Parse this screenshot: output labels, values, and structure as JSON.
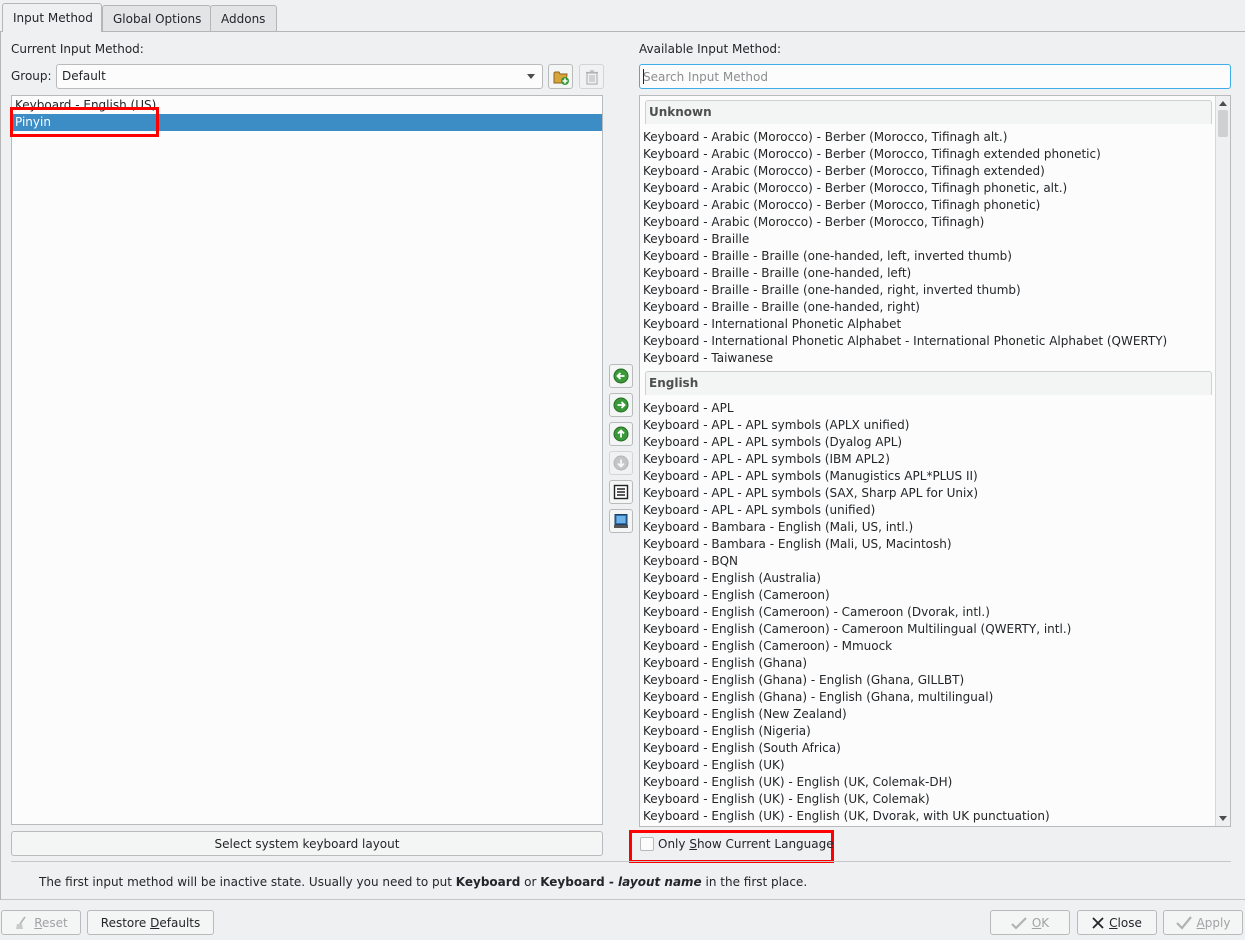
{
  "tabs": [
    {
      "label": "Input Method",
      "active": true
    },
    {
      "label": "Global Options",
      "active": false
    },
    {
      "label": "Addons",
      "active": false
    }
  ],
  "current": {
    "heading": "Current Input Method:",
    "group_label": "Group:",
    "group_value": "Default",
    "items": [
      {
        "label": "Keyboard - English (US)",
        "selected": false
      },
      {
        "label": "Pinyin",
        "selected": true
      }
    ],
    "select_layout_button": "Select system keyboard layout"
  },
  "available": {
    "heading": "Available Input Method:",
    "search_placeholder": "Search Input Method",
    "groups": [
      {
        "name": "Unknown",
        "items": [
          "Keyboard - Arabic (Morocco) - Berber (Morocco, Tifinagh alt.)",
          "Keyboard - Arabic (Morocco) - Berber (Morocco, Tifinagh extended phonetic)",
          "Keyboard - Arabic (Morocco) - Berber (Morocco, Tifinagh extended)",
          "Keyboard - Arabic (Morocco) - Berber (Morocco, Tifinagh phonetic, alt.)",
          "Keyboard - Arabic (Morocco) - Berber (Morocco, Tifinagh phonetic)",
          "Keyboard - Arabic (Morocco) - Berber (Morocco, Tifinagh)",
          "Keyboard - Braille",
          "Keyboard - Braille - Braille (one-handed, left, inverted thumb)",
          "Keyboard - Braille - Braille (one-handed, left)",
          "Keyboard - Braille - Braille (one-handed, right, inverted thumb)",
          "Keyboard - Braille - Braille (one-handed, right)",
          "Keyboard - International Phonetic Alphabet",
          "Keyboard - International Phonetic Alphabet - International Phonetic Alphabet (QWERTY)",
          "Keyboard - Taiwanese"
        ]
      },
      {
        "name": "English",
        "items": [
          "Keyboard - APL",
          "Keyboard - APL - APL symbols (APLX unified)",
          "Keyboard - APL - APL symbols (Dyalog APL)",
          "Keyboard - APL - APL symbols (IBM APL2)",
          "Keyboard - APL - APL symbols (Manugistics APL*PLUS II)",
          "Keyboard - APL - APL symbols (SAX, Sharp APL for Unix)",
          "Keyboard - APL - APL symbols (unified)",
          "Keyboard - Bambara - English (Mali, US, intl.)",
          "Keyboard - Bambara - English (Mali, US, Macintosh)",
          "Keyboard - BQN",
          "Keyboard - English (Australia)",
          "Keyboard - English (Cameroon)",
          "Keyboard - English (Cameroon) - Cameroon (Dvorak, intl.)",
          "Keyboard - English (Cameroon) - Cameroon Multilingual (QWERTY, intl.)",
          "Keyboard - English (Cameroon) - Mmuock",
          "Keyboard - English (Ghana)",
          "Keyboard - English (Ghana) - English (Ghana, GILLBT)",
          "Keyboard - English (Ghana) - English (Ghana, multilingual)",
          "Keyboard - English (New Zealand)",
          "Keyboard - English (Nigeria)",
          "Keyboard - English (South Africa)",
          "Keyboard - English (UK)",
          "Keyboard - English (UK) - English (UK, Colemak-DH)",
          "Keyboard - English (UK) - English (UK, Colemak)",
          "Keyboard - English (UK) - English (UK, Dvorak, with UK punctuation)"
        ]
      }
    ],
    "only_current_language": {
      "pre": "Only ",
      "accel": "S",
      "post": "how Current Language",
      "checked": false
    }
  },
  "middle_buttons": [
    {
      "name": "add-left-button",
      "icon": "arrow-left-icon",
      "disabled": false
    },
    {
      "name": "remove-right-button",
      "icon": "arrow-right-icon",
      "disabled": false
    },
    {
      "name": "move-up-button",
      "icon": "arrow-up-icon",
      "disabled": false
    },
    {
      "name": "move-down-button",
      "icon": "arrow-down-icon",
      "disabled": true
    },
    {
      "name": "configure-button",
      "icon": "list-icon",
      "disabled": false
    },
    {
      "name": "layout-button",
      "icon": "keyboard-layout-icon",
      "disabled": false
    }
  ],
  "info": {
    "text1": "The first input method will be inactive state. Usually you need to put ",
    "bold1": "Keyboard",
    "text2": " or ",
    "bold2": "Keyboard - ",
    "bolditalic": "layout name",
    "text3": " in the first place."
  },
  "footer": {
    "reset": {
      "accel": "R",
      "rest": "eset"
    },
    "restore": {
      "pre": "Restore ",
      "accel": "D",
      "rest": "efaults"
    },
    "ok": {
      "accel": "O",
      "rest": "K"
    },
    "close": {
      "accel": "C",
      "rest": "lose"
    },
    "apply": {
      "accel": "A",
      "rest": "pply"
    }
  },
  "colors": {
    "accent": "#3daee9",
    "selection": "#3c8cc6",
    "highlight_box": "#ff0000",
    "icon_green": "#3a9a3a"
  }
}
